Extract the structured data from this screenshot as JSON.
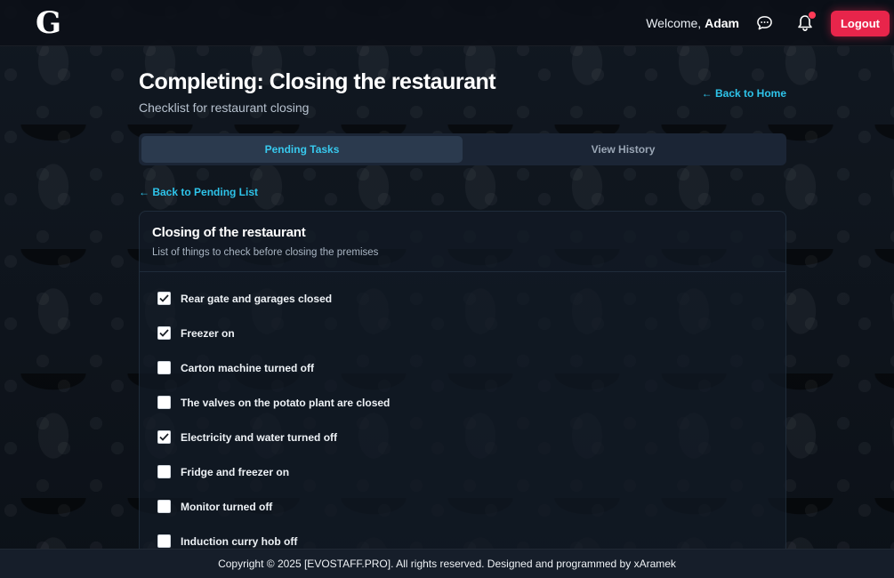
{
  "header": {
    "logo_text": "G",
    "welcome_prefix": "Welcome, ",
    "user_name": "Adam",
    "chat_icon": "chat-bubble-icon",
    "bell_icon": "bell-icon",
    "logout_label": "Logout",
    "accent": "#e8254b"
  },
  "page": {
    "title": "Completing: Closing the restaurant",
    "subtitle": "Checklist for restaurant closing",
    "back_home": "← Back to Home"
  },
  "tabs": [
    {
      "label": "Pending Tasks",
      "active": true
    },
    {
      "label": "View History",
      "active": false
    }
  ],
  "back_pending": "← Back to Pending List",
  "checklist": {
    "title": "Closing of the restaurant",
    "description": "List of things to check before closing the premises",
    "items": [
      {
        "label": "Rear gate and garages closed",
        "checked": true
      },
      {
        "label": "Freezer on",
        "checked": true
      },
      {
        "label": "Carton machine turned off",
        "checked": false
      },
      {
        "label": "The valves on the potato plant are closed",
        "checked": false
      },
      {
        "label": "Electricity and water turned off",
        "checked": true
      },
      {
        "label": "Fridge and freezer on",
        "checked": false
      },
      {
        "label": "Monitor turned off",
        "checked": false
      },
      {
        "label": "Induction curry hob off",
        "checked": false
      }
    ]
  },
  "footer": {
    "text": "Copyright © 2025 [EVOSTAFF.PRO]. All rights reserved. Designed and programmed by xAramek"
  },
  "colors": {
    "link": "#2ec4ea",
    "active_tab_text": "#38c9ee",
    "background": "#0d1219"
  }
}
